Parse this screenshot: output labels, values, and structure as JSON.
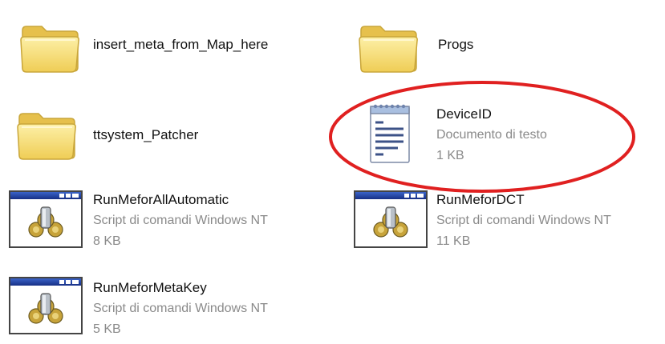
{
  "items": [
    {
      "name": "insert_meta_from_Map_here",
      "type": "folder"
    },
    {
      "name": "Progs",
      "type": "folder"
    },
    {
      "name": "ttsystem_Patcher",
      "type": "folder"
    },
    {
      "name": "DeviceID",
      "type": "text-document",
      "description": "Documento di testo",
      "size": "1 KB"
    },
    {
      "name": "RunMeforAllAutomatic",
      "type": "command-script",
      "description": "Script di comandi Windows NT",
      "size": "8 KB"
    },
    {
      "name": "RunMeforDCT",
      "type": "command-script",
      "description": "Script di comandi Windows NT",
      "size": "11 KB"
    },
    {
      "name": "RunMeforMetaKey",
      "type": "command-script",
      "description": "Script di comandi Windows NT",
      "size": "5 KB"
    }
  ],
  "icons": {
    "folder": "folder-icon",
    "text-document": "notepad-document-icon",
    "command-script": "batch-script-icon"
  },
  "highlight": {
    "target": "DeviceID",
    "color": "#e02020",
    "shape": "ellipse"
  },
  "colors": {
    "folder_fill": "#f7dc6f",
    "folder_edge": "#c9a63a",
    "meta_text": "#8a8a8a",
    "script_titlebar": "#1f3fa0"
  }
}
